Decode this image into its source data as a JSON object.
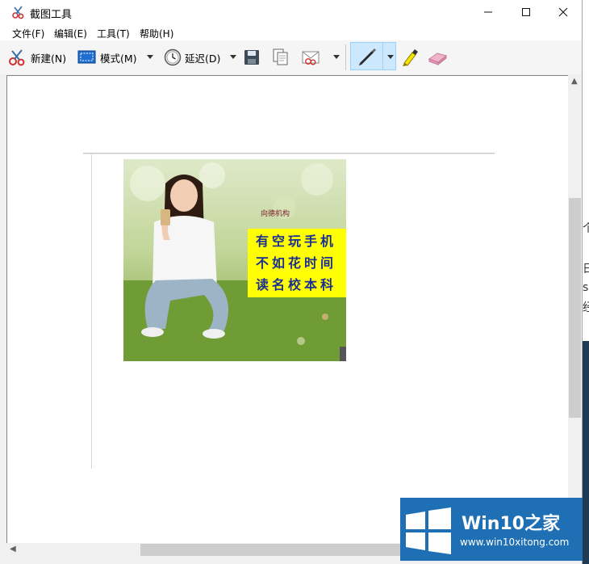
{
  "window": {
    "title": "截图工具",
    "controls": [
      "minimize",
      "maximize",
      "close"
    ]
  },
  "menu": [
    {
      "label": "文件(F)"
    },
    {
      "label": "编辑(E)"
    },
    {
      "label": "工具(T)"
    },
    {
      "label": "帮助(H)"
    }
  ],
  "toolbar": {
    "new_label": "新建(N)",
    "mode_label": "模式(M)",
    "delay_label": "延迟(D)",
    "icons": [
      "scissors-icon",
      "rectangle-icon",
      "clock-icon",
      "save-icon",
      "copy-icon",
      "send-email-icon",
      "pen-icon",
      "highlighter-icon",
      "eraser-icon"
    ]
  },
  "snip": {
    "ad_logo": "向德机构",
    "ad_lines": [
      "有空玩手机",
      "不如花时间",
      "读名校本科"
    ]
  },
  "background_fragments": [
    "个",
    "日",
    "s",
    "经",
    "s"
  ],
  "watermark": {
    "brand": "Win10之家",
    "url": "www.win10xitong.com"
  },
  "colors": {
    "pen_selected_bg": "#cce8ff",
    "ad_yellow": "#fffe04",
    "ad_text": "#1b2f93",
    "watermark_blue": "#1f6fb4"
  }
}
